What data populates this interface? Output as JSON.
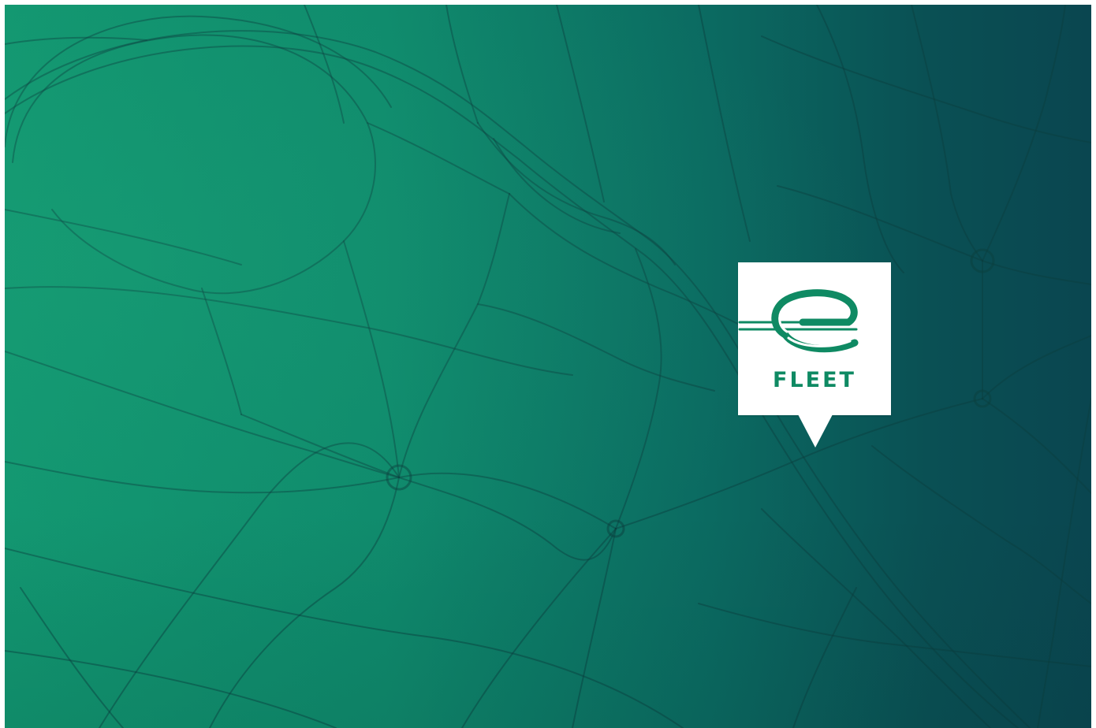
{
  "brand": {
    "name": "FLEET",
    "logo_icon": "enterprise-e-logo-icon",
    "logo_color": "#0f8a63",
    "pin_color": "#ffffff"
  },
  "background": {
    "gradient_left": "#129670",
    "gradient_right": "#0a4650",
    "road_color": "#0a3f3d"
  }
}
